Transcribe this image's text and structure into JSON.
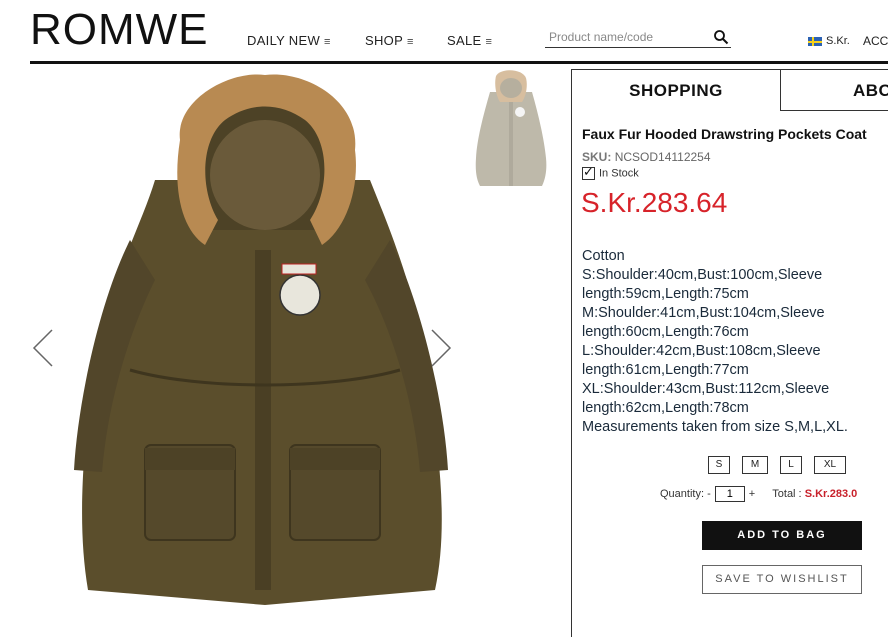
{
  "header": {
    "logo": "ROMWE",
    "nav": [
      {
        "label": "DAILY NEW",
        "icon": "menu-lines-icon"
      },
      {
        "label": "SHOP",
        "icon": "menu-lines-icon"
      },
      {
        "label": "SALE",
        "icon": "menu-lines-icon"
      }
    ],
    "search": {
      "placeholder": "Product name/code",
      "icon": "search-icon"
    },
    "flag_icon": "sweden-flag-icon",
    "currency": "S.Kr.",
    "account": "ACC"
  },
  "gallery": {
    "prev_icon": "chevron-left-icon",
    "next_icon": "chevron-right-icon"
  },
  "tabs": [
    {
      "label": "SHOPPING",
      "active": true
    },
    {
      "label": "ABO",
      "active": false
    }
  ],
  "product": {
    "title": "Faux Fur Hooded Drawstring Pockets Coat",
    "sku_label": "SKU:",
    "sku": "NCSOD14112254",
    "stock": "In Stock",
    "price": "S.Kr.283.64",
    "description": [
      "Cotton",
      "S:Shoulder:40cm,Bust:100cm,Sleeve",
      "length:59cm,Length:75cm",
      "M:Shoulder:41cm,Bust:104cm,Sleeve",
      "length:60cm,Length:76cm",
      "L:Shoulder:42cm,Bust:108cm,Sleeve",
      "length:61cm,Length:77cm",
      "XL:Shoulder:43cm,Bust:112cm,Sleeve",
      "length:62cm,Length:78cm",
      "Measurements taken from size S,M,L,XL."
    ],
    "sizes": [
      "S",
      "M",
      "L",
      "XL"
    ],
    "quantity_label": "Quantity:",
    "quantity_minus": "-",
    "quantity_value": "1",
    "quantity_plus": "+",
    "total_label": "Total :",
    "total_value": "S.Kr.283.0",
    "add_to_bag": "ADD TO BAG",
    "save_to_wishlist": "SAVE TO WISHLIST"
  },
  "colors": {
    "price": "#d7232a",
    "coat": "#5b4e2c",
    "fur": "#b88a52",
    "button": "#111111"
  }
}
